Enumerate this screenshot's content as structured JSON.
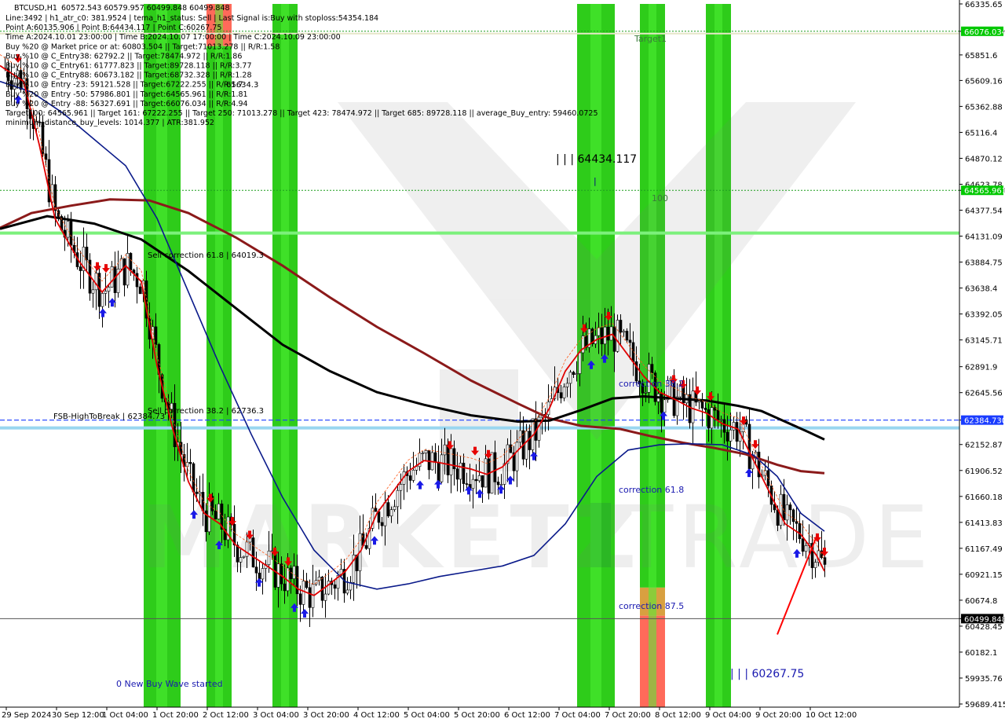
{
  "window": {
    "symbol_title": "BTCUSD,H1"
  },
  "header": {
    "ohlc": "60572.543 60579.957 60499.848 60499.848",
    "lines": [
      "Line:3492 | h1_atr_c0: 381.9524 | tema_h1_status: Sell | Last Signal is:Buy with stoploss:54354.184",
      "Point A:60135.906 | Point B:64434.117 | Point C:60267.75",
      "Time A:2024.10.01 23:00:00 | Time B:2024.10.07 17:00:00 | Time C:2024.10.09 23:00:00",
      "Buy %20 @ Market price or at: 60803.504 || Target:71013.278 || R/R:1.58",
      "Buy %10 @ C_Entry38: 62792.2 || Target:78474.972 || R/R:1.86",
      "Buy %10 @ C_Entry61: 61777.823 || Target:89728.118 || R/R:3.77",
      "Buy %10 @ C_Entry88: 60673.182 || Target:68732.328 || R/R:1.28",
      "Buy %10 @ Entry -23: 59121.528 || Target:67222.255 || R/R:1.7",
      "Buy %20 @ Entry -50: 57986.801 || Target:64565.961 || R/R:1.81",
      "Buy %20 @ Entry -88: 56327.691 || Target:66076.034 || R/R:4.94",
      "Target100: 64565.961 || Target 161: 67222.255 || Target 250: 71013.278 || Target 423: 78474.972 || Target 685: 89728.118 || average_Buy_entry: 59460.0725",
      "minimum_distance_buy_levels: 1014.377 | ATR:381.952"
    ]
  },
  "chart_data": {
    "type": "candlestick",
    "symbol": "BTCUSD",
    "timeframe": "H1",
    "y_ticks": [
      66335.65,
      66076.034,
      65851.6,
      65609.16,
      65362.88,
      65116.4,
      64870.12,
      64623.78,
      64565.961,
      64377.54,
      64131.09,
      63884.75,
      63638.4,
      63392.05,
      63145.71,
      62891.9,
      62645.56,
      62384.73,
      62152.87,
      61906.52,
      61660.18,
      61413.83,
      61167.49,
      60921.15,
      60674.8,
      60499.848,
      60428.45,
      60182.1,
      59935.76,
      59689.415
    ],
    "x_ticks": [
      "29 Sep 2024",
      "30 Sep 12:00",
      "1 Oct 04:00",
      "1 Oct 20:00",
      "2 Oct 12:00",
      "3 Oct 04:00",
      "3 Oct 20:00",
      "4 Oct 12:00",
      "5 Oct 04:00",
      "5 Oct 20:00",
      "6 Oct 12:00",
      "7 Oct 04:00",
      "7 Oct 20:00",
      "8 Oct 12:00",
      "9 Oct 04:00",
      "9 Oct 20:00",
      "10 Oct 12:00"
    ],
    "ylim": [
      59689.415,
      66335.65
    ],
    "annotations": {
      "target_label": "Target1",
      "point_b_label": "| | | 64434.117",
      "point_b_tick": "|",
      "level_100": "100",
      "sell_corr_618": "Sell correction 61.8 | 64019.3",
      "sell_corr_382": "Sell correction 38.2 | 62736.3",
      "fsb_label": "FSB-HighToBreak | 62384.73",
      "corr_382": "correction 38.2",
      "corr_618": "correction 61.8",
      "corr_875": "correction 87.5",
      "new_buy_wave": "0 New Buy Wave started",
      "point_c_label": "| | | 60267.75",
      "overlap_label": "65634.3"
    },
    "price_flags": [
      {
        "value": 66076.034,
        "label": "66076.034",
        "bg": "#00c800",
        "fg": "#ffffff"
      },
      {
        "value": 64565.961,
        "label": "64565.961",
        "bg": "#00c800",
        "fg": "#ffffff"
      },
      {
        "value": 62384.73,
        "label": "62384.730",
        "bg": "#1a3cff",
        "fg": "#ffffff"
      },
      {
        "value": 60499.848,
        "label": "60499.848",
        "bg": "#000000",
        "fg": "#ffffff"
      }
    ],
    "zones": [
      {
        "col": 0,
        "t0": 0.0,
        "t1": 1.0,
        "color": "#2ecc1a"
      },
      {
        "col": 1,
        "t0": 0.0,
        "t1": 0.06,
        "color": "#ff6a5a"
      },
      {
        "col": 1,
        "t0": 0.06,
        "t1": 1.0,
        "color": "#2ecc1a"
      },
      {
        "col": 2,
        "t0": 0.0,
        "t1": 1.0,
        "color": "#2ecc1a"
      },
      {
        "col": 3,
        "t0": 0.0,
        "t1": 1.0,
        "color": "#2ecc1a"
      },
      {
        "col": 4,
        "t0": 0.0,
        "t1": 0.83,
        "color": "#2ecc1a"
      },
      {
        "col": 4,
        "t0": 0.83,
        "t1": 0.87,
        "color": "#d8a040"
      },
      {
        "col": 4,
        "t0": 0.87,
        "t1": 1.0,
        "color": "#ff6a5a"
      },
      {
        "col": 5,
        "t0": 0.0,
        "t1": 1.0,
        "color": "#2ecc1a"
      }
    ],
    "series": [
      {
        "name": "",
        "color": "#8b1a1a",
        "points": [
          [
            0,
            64210
          ],
          [
            40,
            64350
          ],
          [
            90,
            64420
          ],
          [
            140,
            64480
          ],
          [
            190,
            64470
          ],
          [
            240,
            64350
          ],
          [
            300,
            64120
          ],
          [
            360,
            63850
          ],
          [
            420,
            63550
          ],
          [
            480,
            63270
          ],
          [
            540,
            63020
          ],
          [
            600,
            62760
          ],
          [
            660,
            62540
          ],
          [
            700,
            62400
          ],
          [
            740,
            62330
          ],
          [
            790,
            62300
          ],
          [
            830,
            62230
          ],
          [
            870,
            62170
          ],
          [
            910,
            62120
          ],
          [
            950,
            62060
          ],
          [
            990,
            61960
          ],
          [
            1020,
            61900
          ],
          [
            1050,
            61880
          ]
        ]
      },
      {
        "name": "",
        "color": "#000000",
        "points": [
          [
            0,
            64200
          ],
          [
            60,
            64320
          ],
          [
            120,
            64250
          ],
          [
            180,
            64100
          ],
          [
            240,
            63800
          ],
          [
            300,
            63450
          ],
          [
            360,
            63100
          ],
          [
            420,
            62850
          ],
          [
            480,
            62650
          ],
          [
            540,
            62530
          ],
          [
            600,
            62430
          ],
          [
            660,
            62370
          ],
          [
            700,
            62380
          ],
          [
            740,
            62480
          ],
          [
            780,
            62590
          ],
          [
            820,
            62610
          ],
          [
            860,
            62590
          ],
          [
            900,
            62570
          ],
          [
            940,
            62520
          ],
          [
            970,
            62470
          ],
          [
            1000,
            62370
          ],
          [
            1030,
            62270
          ],
          [
            1050,
            62200
          ]
        ]
      },
      {
        "name": "",
        "color": "#0a1a8a",
        "points": [
          [
            0,
            65600
          ],
          [
            40,
            65500
          ],
          [
            80,
            65300
          ],
          [
            120,
            65050
          ],
          [
            160,
            64800
          ],
          [
            200,
            64300
          ],
          [
            240,
            63600
          ],
          [
            280,
            62900
          ],
          [
            320,
            62250
          ],
          [
            360,
            61650
          ],
          [
            400,
            61150
          ],
          [
            440,
            60850
          ],
          [
            480,
            60780
          ],
          [
            520,
            60830
          ],
          [
            560,
            60900
          ],
          [
            600,
            60950
          ],
          [
            640,
            61000
          ],
          [
            680,
            61100
          ],
          [
            720,
            61400
          ],
          [
            760,
            61850
          ],
          [
            800,
            62100
          ],
          [
            840,
            62150
          ],
          [
            880,
            62160
          ],
          [
            920,
            62150
          ],
          [
            960,
            62050
          ],
          [
            990,
            61850
          ],
          [
            1020,
            61500
          ],
          [
            1050,
            61330
          ]
        ]
      },
      {
        "name": "",
        "color": "#e00000",
        "points": [
          [
            0,
            65750
          ],
          [
            30,
            65600
          ],
          [
            50,
            65000
          ],
          [
            70,
            64300
          ],
          [
            100,
            63900
          ],
          [
            130,
            63600
          ],
          [
            160,
            63850
          ],
          [
            180,
            63700
          ],
          [
            200,
            62900
          ],
          [
            220,
            62300
          ],
          [
            240,
            61800
          ],
          [
            260,
            61500
          ],
          [
            280,
            61400
          ],
          [
            300,
            61200
          ],
          [
            320,
            61100
          ],
          [
            340,
            61000
          ],
          [
            360,
            60900
          ],
          [
            380,
            60780
          ],
          [
            400,
            60720
          ],
          [
            420,
            60830
          ],
          [
            440,
            60950
          ],
          [
            460,
            61150
          ],
          [
            480,
            61500
          ],
          [
            500,
            61700
          ],
          [
            520,
            61900
          ],
          [
            540,
            62000
          ],
          [
            560,
            61980
          ],
          [
            580,
            61950
          ],
          [
            600,
            61920
          ],
          [
            620,
            61870
          ],
          [
            640,
            61940
          ],
          [
            660,
            62100
          ],
          [
            680,
            62250
          ],
          [
            700,
            62500
          ],
          [
            720,
            62850
          ],
          [
            740,
            63050
          ],
          [
            760,
            63150
          ],
          [
            780,
            63200
          ],
          [
            800,
            63000
          ],
          [
            820,
            62800
          ],
          [
            840,
            62650
          ],
          [
            860,
            62580
          ],
          [
            880,
            62500
          ],
          [
            900,
            62450
          ],
          [
            920,
            62350
          ],
          [
            940,
            62300
          ],
          [
            960,
            62000
          ],
          [
            980,
            61700
          ],
          [
            1000,
            61400
          ],
          [
            1020,
            61300
          ],
          [
            1040,
            61100
          ],
          [
            1050,
            60950
          ]
        ]
      }
    ],
    "candles_note": "",
    "buy_arrows_x": [
      23,
      143,
      131,
      247,
      279,
      330,
      375,
      388,
      477,
      535,
      558,
      597,
      611,
      638,
      650,
      680,
      753,
      770,
      845,
      954,
      1015
    ],
    "sell_arrows_x": [
      23,
      124,
      135,
      268,
      296,
      318,
      350,
      367,
      573,
      605,
      622,
      744,
      775,
      858,
      870,
      888,
      905,
      947,
      962,
      1041,
      1050
    ]
  }
}
